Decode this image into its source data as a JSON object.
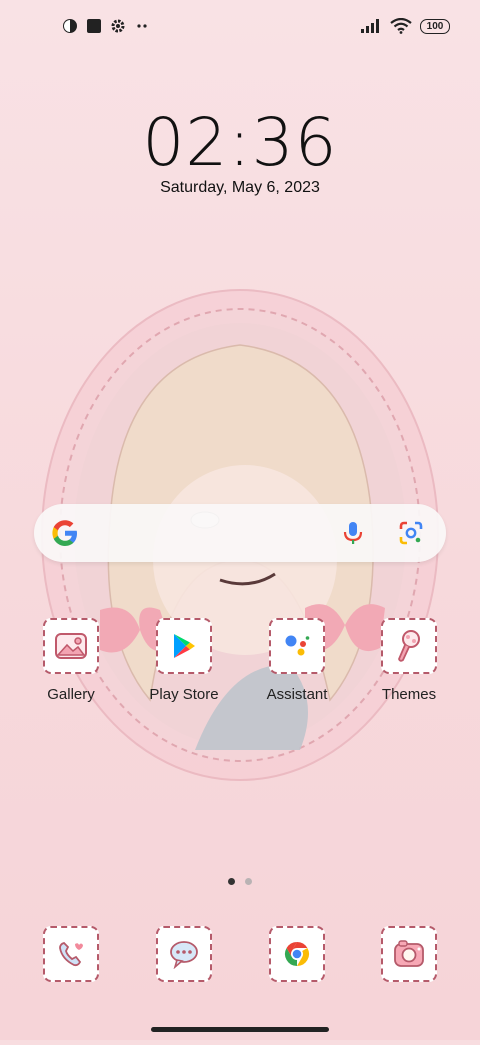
{
  "status": {
    "battery": "100"
  },
  "lockscreen": {
    "time": "02:36",
    "date": "Saturday, May 6, 2023"
  },
  "search": {
    "icons": [
      "google-g-icon",
      "microphone-icon",
      "google-lens-icon"
    ]
  },
  "apps": [
    {
      "label": "Gallery",
      "icon": "gallery-icon"
    },
    {
      "label": "Play Store",
      "icon": "play-store-icon"
    },
    {
      "label": "Assistant",
      "icon": "assistant-icon"
    },
    {
      "label": "Themes",
      "icon": "themes-icon"
    }
  ],
  "dock": [
    {
      "icon": "phone-icon"
    },
    {
      "icon": "messages-icon"
    },
    {
      "icon": "chrome-icon"
    },
    {
      "icon": "camera-icon"
    }
  ],
  "pages": {
    "count": 2,
    "active": 1
  },
  "colors": {
    "background": "#f8dde0",
    "tile_border": "#b55a6a",
    "active_dot": "#333333",
    "inactive_dot": "#b9b3b4"
  }
}
